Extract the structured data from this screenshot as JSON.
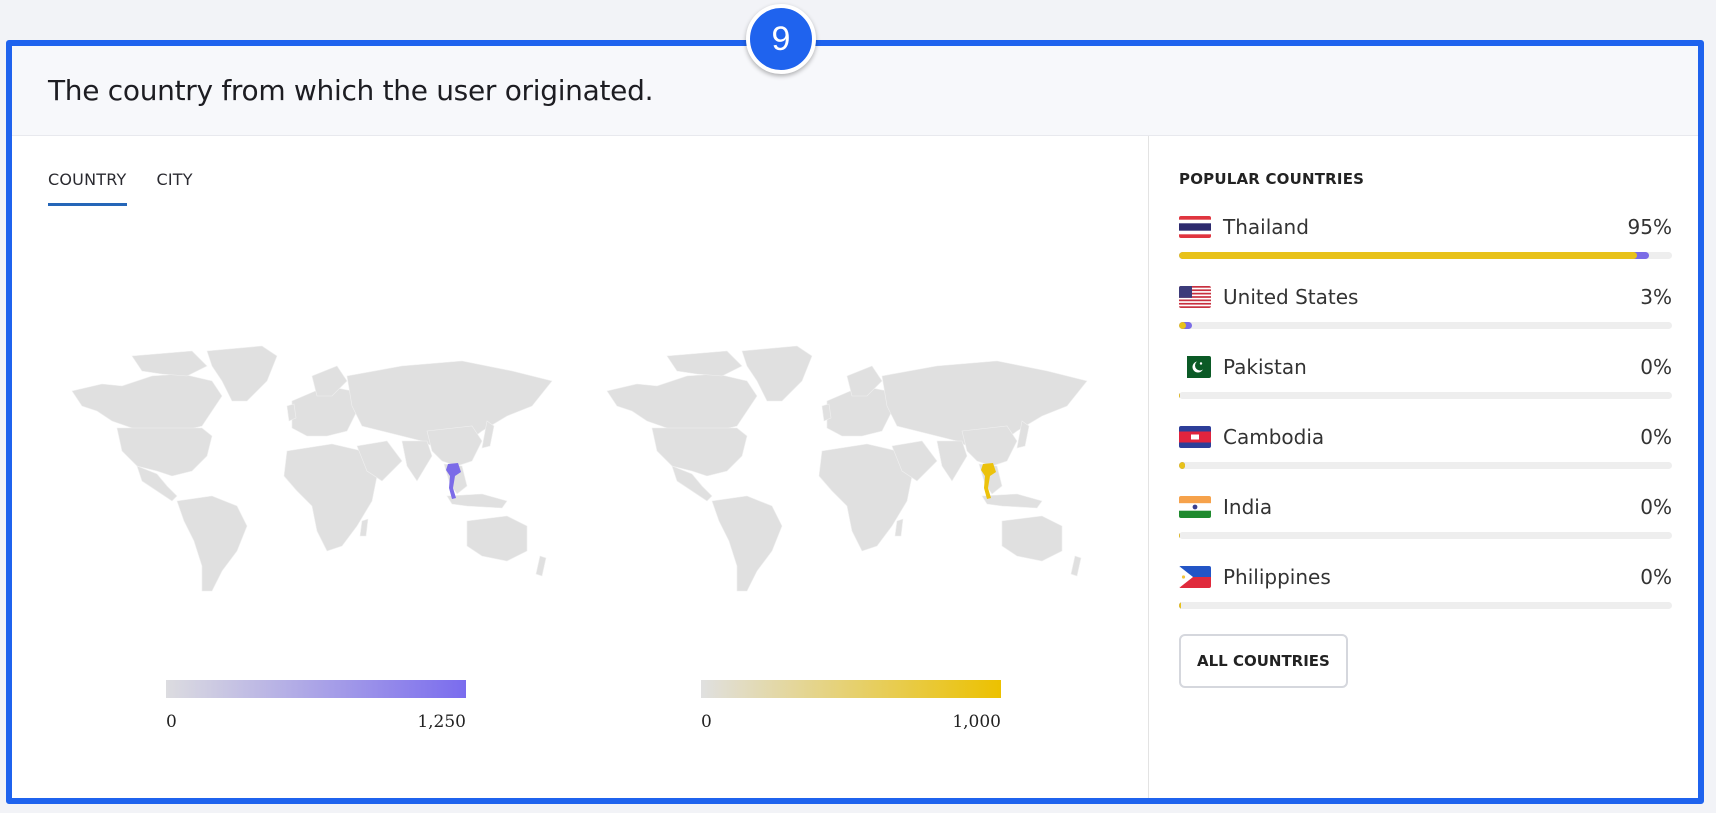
{
  "badge": {
    "number": "9"
  },
  "header": {
    "title": "The country from which the user originated."
  },
  "tabs": [
    {
      "label": "COUNTRY",
      "active": true
    },
    {
      "label": "CITY",
      "active": false
    }
  ],
  "maps": [
    {
      "name": "purple-map",
      "highlight_country": "Thailand",
      "highlight_color": "#7b6be8",
      "land_color": "#e0e0e0",
      "legend": {
        "min": "0",
        "max": "1,250",
        "from_color": "#dcdce0",
        "to_color": "#7a6cee"
      }
    },
    {
      "name": "yellow-map",
      "highlight_country": "Thailand",
      "highlight_color": "#ecc20b",
      "land_color": "#e0e0e0",
      "legend": {
        "min": "0",
        "max": "1,000",
        "from_color": "#e0e0e0",
        "to_color": "#ecc100"
      }
    }
  ],
  "popular": {
    "title": "POPULAR COUNTRIES",
    "colors": {
      "primary": "#e8c21a",
      "secondary": "#7b6ce6",
      "track": "#eeeeee"
    },
    "countries": [
      {
        "name": "Thailand",
        "percent": "95%",
        "flag": "thailand-flag",
        "primary_pct": 93,
        "secondary_pct": 2.3
      },
      {
        "name": "United States",
        "percent": "3%",
        "flag": "us-flag",
        "primary_pct": 1.5,
        "secondary_pct": 1.2
      },
      {
        "name": "Pakistan",
        "percent": "0%",
        "flag": "pakistan-flag",
        "primary_pct": 0.3,
        "secondary_pct": 0
      },
      {
        "name": "Cambodia",
        "percent": "0%",
        "flag": "cambodia-flag",
        "primary_pct": 1.2,
        "secondary_pct": 0
      },
      {
        "name": "India",
        "percent": "0%",
        "flag": "india-flag",
        "primary_pct": 0.3,
        "secondary_pct": 0
      },
      {
        "name": "Philippines",
        "percent": "0%",
        "flag": "philippines-flag",
        "primary_pct": 0.4,
        "secondary_pct": 0
      }
    ],
    "button_label": "ALL COUNTRIES"
  }
}
